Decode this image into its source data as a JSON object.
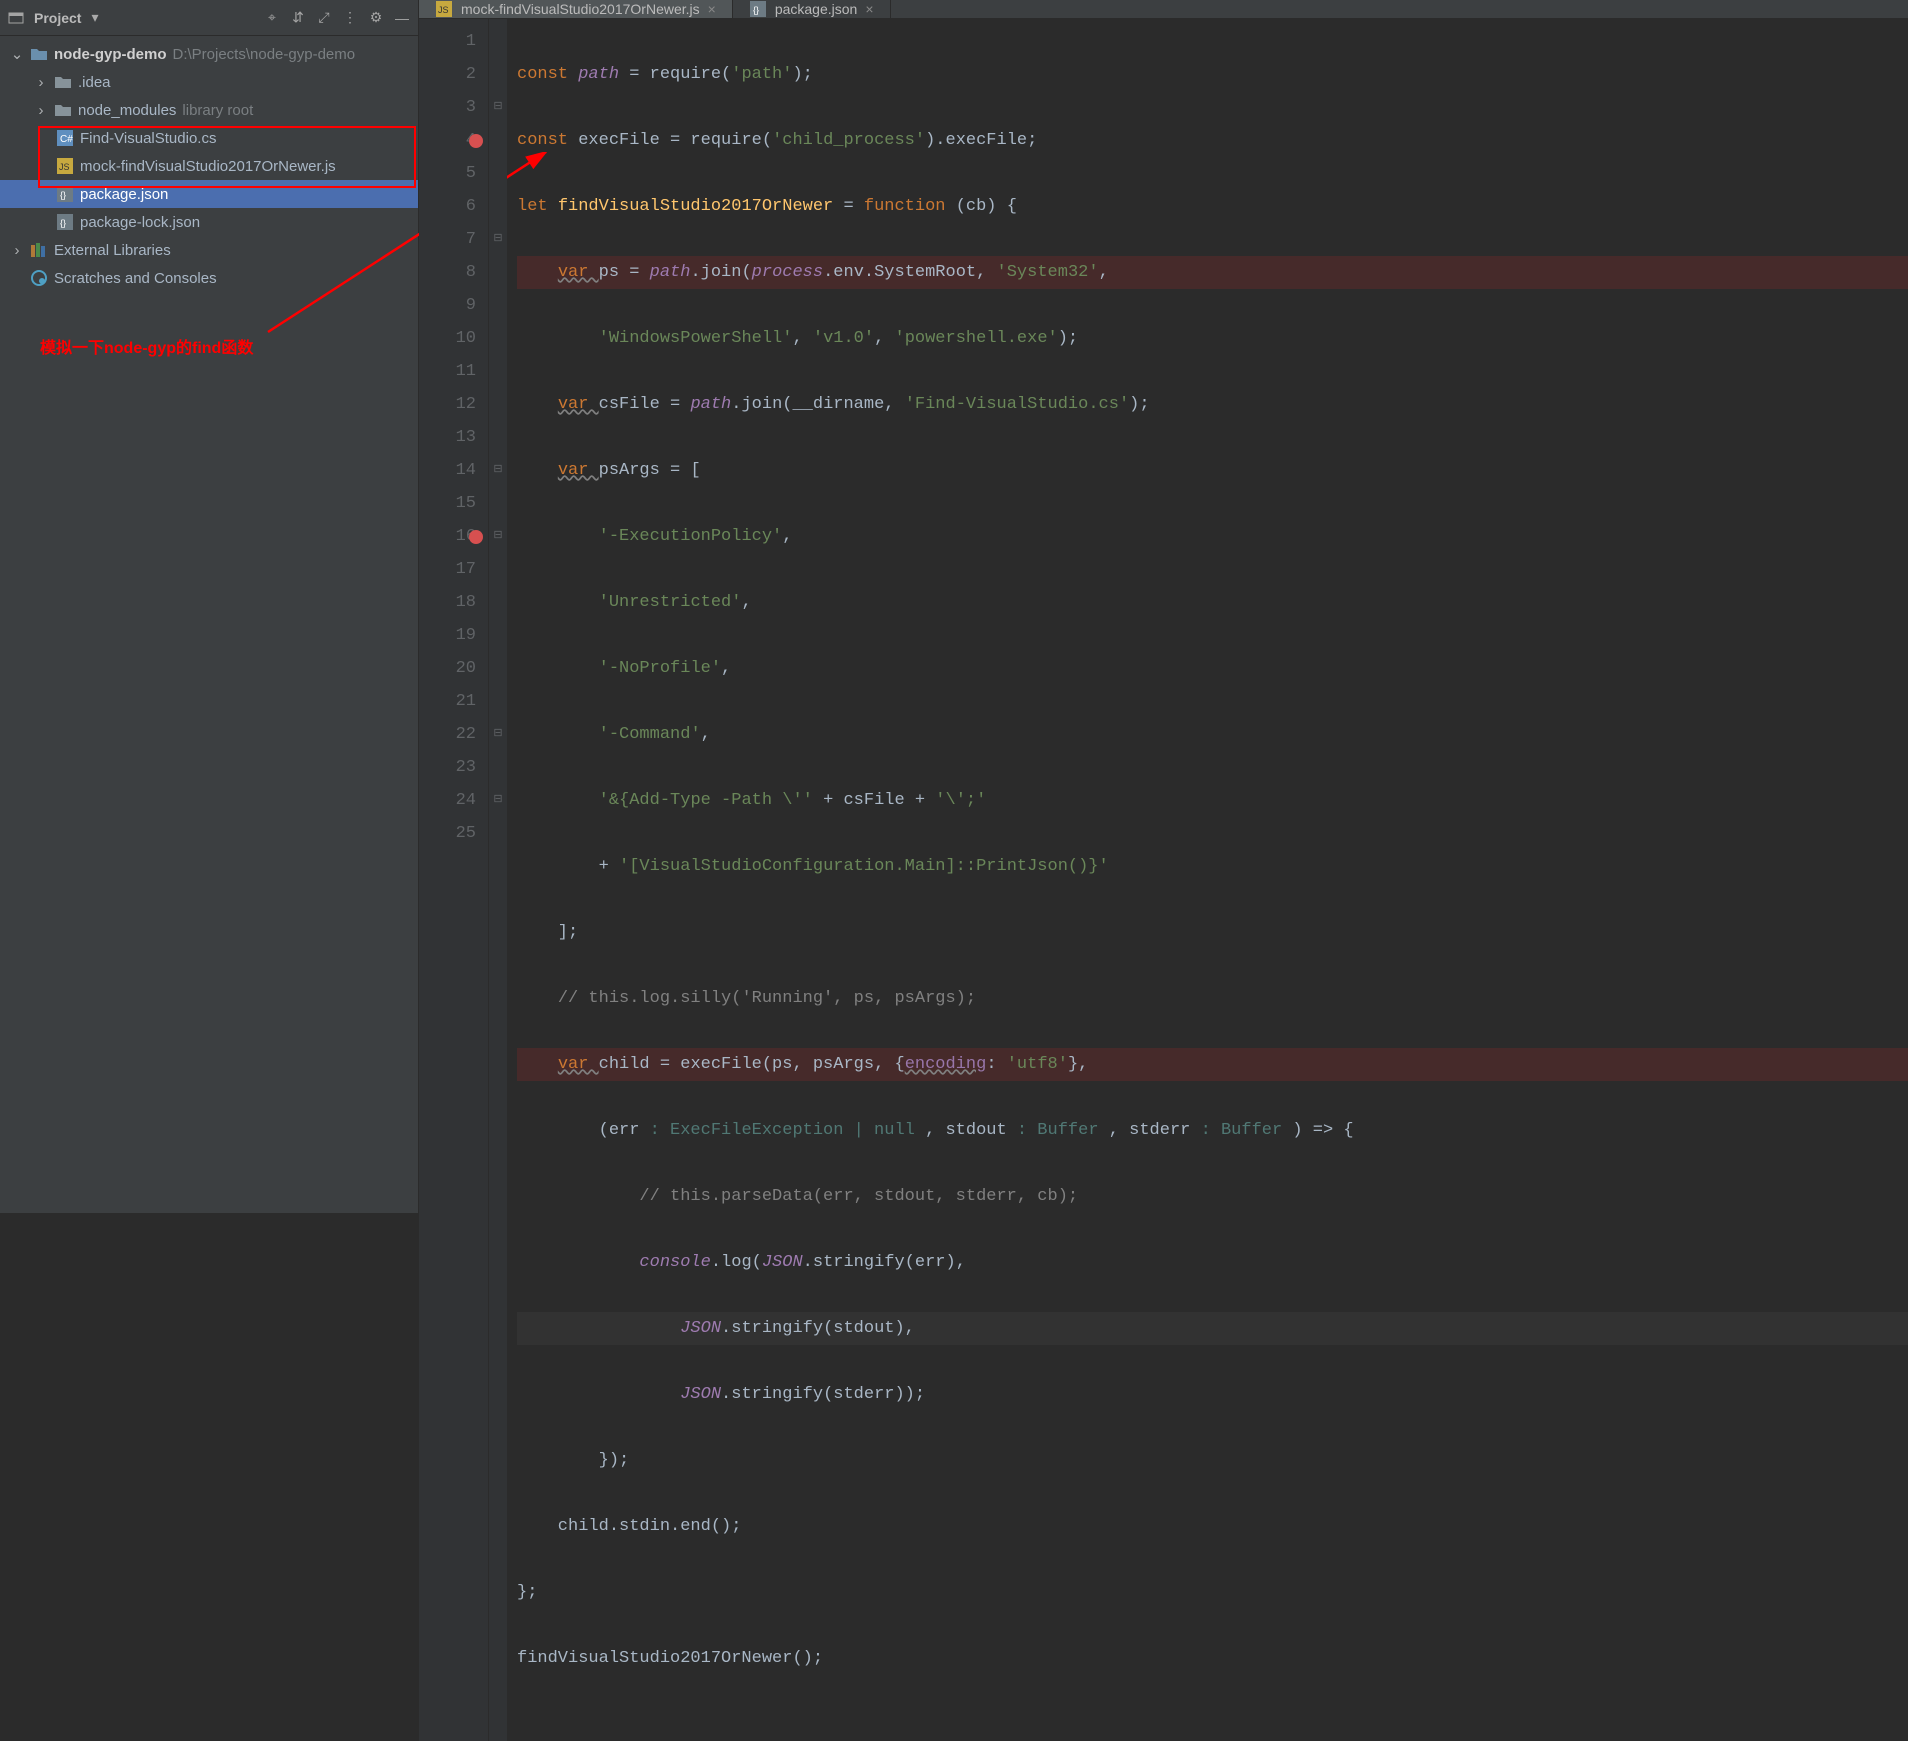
{
  "panel": {
    "title": "Project",
    "toolbar_glyphs": {
      "target": "⌖",
      "collapse": "⇵",
      "expand": "⤢",
      "div": "⋮",
      "gear": "⚙",
      "minimize": "—"
    },
    "tree": {
      "root": {
        "chev": "⌄",
        "name": "node-gyp-demo",
        "path": "D:\\Projects\\node-gyp-demo"
      },
      "idea": {
        "chev": "›",
        "name": ".idea"
      },
      "node_modules": {
        "chev": "›",
        "name": "node_modules",
        "hint": "library root"
      },
      "file_cs": "Find-VisualStudio.cs",
      "file_mock": "mock-findVisualStudio2017OrNewer.js",
      "file_pkg": "package.json",
      "file_lock": "package-lock.json",
      "ext_lib": {
        "chev": "›",
        "name": "External Libraries"
      },
      "scratch": {
        "name": "Scratches and Consoles"
      }
    },
    "annotation": "模拟一下node-gyp的find函数"
  },
  "tabs": {
    "active": {
      "icon": "JS",
      "label": "mock-findVisualStudio2017OrNewer.js",
      "close": "×"
    },
    "second": {
      "icon": "{}",
      "label": "package.json",
      "close": "×"
    }
  },
  "gutter": {
    "breakpoints": [
      4,
      16
    ],
    "fold": {
      "3": "⊟",
      "7": "⊟",
      "14": "⊟",
      "16": "⊟",
      "22": "⊟",
      "24": "⊟"
    }
  },
  "code": {
    "l1": {
      "a": "const ",
      "b": "path",
      "c": " = require(",
      "d": "'path'",
      "e": ");"
    },
    "l2": {
      "a": "const ",
      "b": "execFile = require(",
      "c": "'child_process'",
      "d": ").execFile;"
    },
    "l3": {
      "a": "let ",
      "b": "findVisualStudio2017OrNewer",
      "c": " = ",
      "d": "function",
      "e": " (cb) {"
    },
    "l4": {
      "a": "    ",
      "b": "var ",
      "c": "ps = ",
      "d": "path",
      "e": ".join(",
      "f": "process",
      "g": ".env.SystemRoot, ",
      "h": "'System32'",
      "i": ","
    },
    "l5": {
      "a": "        ",
      "b": "'WindowsPowerShell'",
      "c": ", ",
      "d": "'v1.0'",
      "e": ", ",
      "f": "'powershell.exe'",
      "g": ");"
    },
    "l6": {
      "a": "    ",
      "b": "var ",
      "c": "csFile = ",
      "d": "path",
      "e": ".join(__dirname, ",
      "f": "'Find-VisualStudio.cs'",
      "g": ");"
    },
    "l7": {
      "a": "    ",
      "b": "var ",
      "c": "psArgs = ["
    },
    "l8": {
      "a": "        ",
      "b": "'-ExecutionPolicy'",
      "c": ","
    },
    "l9": {
      "a": "        ",
      "b": "'Unrestricted'",
      "c": ","
    },
    "l10": {
      "a": "        ",
      "b": "'-NoProfile'",
      "c": ","
    },
    "l11": {
      "a": "        ",
      "b": "'-Command'",
      "c": ","
    },
    "l12": {
      "a": "        ",
      "b": "'&{Add-Type -Path \\''",
      "c": " + csFile + ",
      "d": "'\\';'"
    },
    "l13": {
      "a": "        + ",
      "b": "'[VisualStudioConfiguration.Main]::PrintJson()}'"
    },
    "l14": {
      "a": "    ];"
    },
    "l15": {
      "a": "    ",
      "b": "// this.log.silly('Running', ps, psArgs);"
    },
    "l16": {
      "a": "    ",
      "b": "var ",
      "c": "child = execFile(ps, psArgs, {",
      "d": "encoding",
      "e": ": ",
      "f": "'utf8'",
      "g": "},"
    },
    "l17": {
      "a": "        (err ",
      "t1": ": ExecFileException | null",
      "b": " , stdout ",
      "t2": ": Buffer",
      "c": " , stderr ",
      "t3": ": Buffer",
      "d": " ) => {"
    },
    "l18": {
      "a": "            ",
      "b": "// this.parseData(err, stdout, stderr, cb);"
    },
    "l19": {
      "a": "            ",
      "b": "console",
      "c": ".log(",
      "d": "JSON",
      "e": ".stringify(err),"
    },
    "l20": {
      "a": "                ",
      "b": "JSON",
      "c": ".stringify(stdout),"
    },
    "l21": {
      "a": "                ",
      "b": "JSON",
      "c": ".stringify(stderr));"
    },
    "l22": {
      "a": "        });"
    },
    "l23": {
      "a": "    child.stdin.end();"
    },
    "l24": {
      "a": "};"
    },
    "l25": {
      "a": "findVisualStudio2017OrNewer();"
    }
  }
}
